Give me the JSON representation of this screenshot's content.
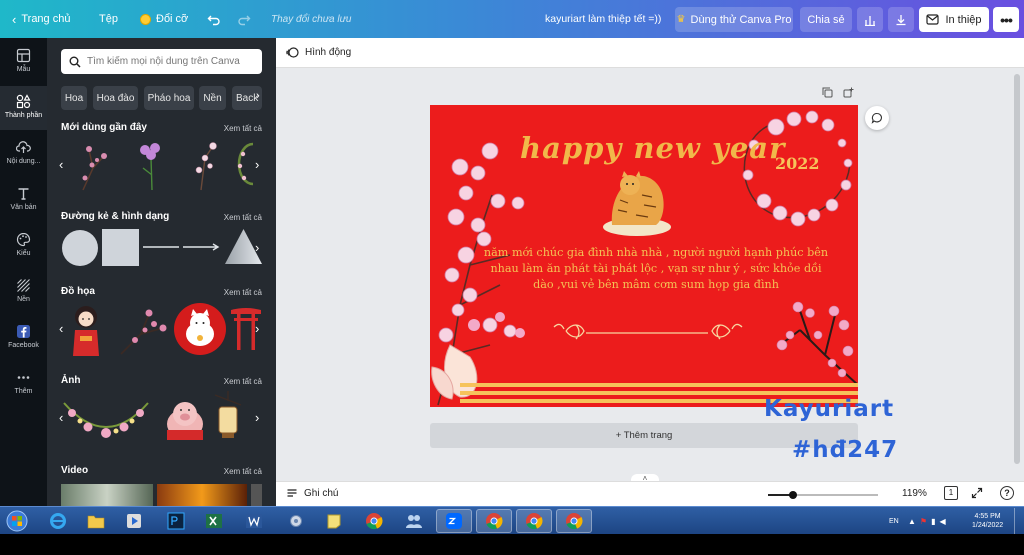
{
  "topbar": {
    "home": "Trang chủ",
    "file": "Tệp",
    "resize": "Đổi cỡ",
    "save_status": "Thay đổi chưa lưu",
    "project_title": "kayuriart làm thiệp tết =))",
    "try_pro": "Dùng thử Canva Pro",
    "share": "Chia sẻ",
    "print": "In thiệp"
  },
  "rail": {
    "items": [
      {
        "label": "Mẫu",
        "icon": "template-icon"
      },
      {
        "label": "Thành phần",
        "icon": "elements-icon"
      },
      {
        "label": "Nội dung...",
        "icon": "upload-icon"
      },
      {
        "label": "Văn bản",
        "icon": "text-icon"
      },
      {
        "label": "Kiểu",
        "icon": "palette-icon"
      },
      {
        "label": "Nền",
        "icon": "background-icon"
      },
      {
        "label": "Facebook",
        "icon": "facebook-icon"
      },
      {
        "label": "Thêm",
        "icon": "more-icon"
      }
    ]
  },
  "panel": {
    "search_placeholder": "Tìm kiếm mọi nội dung trên Canva",
    "chips": [
      "Hoa",
      "Hoa đào",
      "Pháo hoa",
      "Nền",
      "Back"
    ],
    "see_all": "Xem tất cả",
    "sections": [
      "Mới dùng gần đây",
      "Đường kẻ & hình dạng",
      "Đồ họa",
      "Ảnh",
      "Video"
    ]
  },
  "editor": {
    "animate": "Hình động",
    "notes": "Ghi chú",
    "zoom": "119%",
    "page_count": "1",
    "add_page": "+ Thêm trang"
  },
  "card": {
    "greeting": "happy new year",
    "year": "2022",
    "wish_lines": [
      "năm mới chúc gia đình nhà nhà , người người hạnh phúc bên",
      "nhau làm ăn phát tài phát lộc , vạn sự như ý , sức khỏe dồi",
      "dào ,vui vẻ bên mâm cơm sum họp gia đình"
    ]
  },
  "watermark": {
    "line1": "Kayuriart",
    "line2": "#hđ247"
  },
  "taskbar": {
    "lang": "EN",
    "time": "4:55 PM",
    "date": "1/24/2022"
  },
  "colors": {
    "card_red": "#ec1c1c",
    "gold": "#f1b84a",
    "blossom": "#f3a9c8",
    "panel_dark": "#252a30",
    "watermark_blue": "#2e64d6"
  }
}
